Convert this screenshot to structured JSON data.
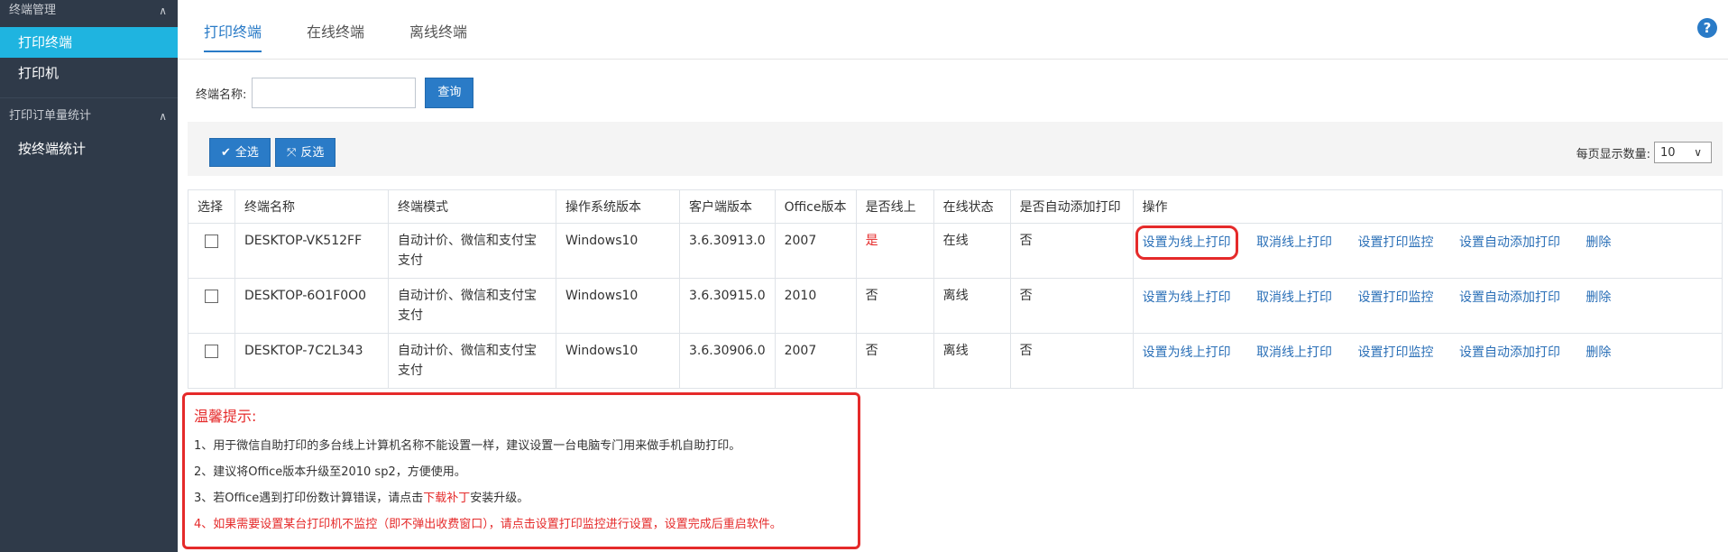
{
  "sidebar": {
    "group1": {
      "label": "终端管理",
      "chevron": "∧"
    },
    "items": [
      {
        "label": "打印终端",
        "active": true
      },
      {
        "label": "打印机",
        "active": false
      }
    ],
    "group2": {
      "label": "打印订单量统计",
      "chevron": "∧"
    },
    "items2": [
      {
        "label": "按终端统计"
      }
    ]
  },
  "tabs": [
    {
      "label": "打印终端",
      "active": true
    },
    {
      "label": "在线终端",
      "active": false
    },
    {
      "label": "离线终端",
      "active": false
    }
  ],
  "help_icon": "?",
  "filter": {
    "label": "终端名称:",
    "value": "",
    "placeholder": "",
    "query_button": "查询"
  },
  "toolbar": {
    "select_all": "全选",
    "invert": "反选",
    "page_size_label": "每页显示数量:",
    "page_size_value": "10"
  },
  "table": {
    "headers": [
      "选择",
      "终端名称",
      "终端模式",
      "操作系统版本",
      "客户端版本",
      "Office版本",
      "是否线上",
      "在线状态",
      "是否自动添加打印",
      "操作"
    ],
    "rows": [
      {
        "name": "DESKTOP-VK512FF",
        "mode": "自动计价、微信和支付宝支付",
        "os": "Windows10",
        "client": "3.6.30913.0",
        "office": "2007",
        "online": "是",
        "status": "在线",
        "auto_add": "否"
      },
      {
        "name": "DESKTOP-6O1F0O0",
        "mode": "自动计价、微信和支付宝支付",
        "os": "Windows10",
        "client": "3.6.30915.0",
        "office": "2010",
        "online": "否",
        "status": "离线",
        "auto_add": "否"
      },
      {
        "name": "DESKTOP-7C2L343",
        "mode": "自动计价、微信和支付宝支付",
        "os": "Windows10",
        "client": "3.6.30906.0",
        "office": "2007",
        "online": "否",
        "status": "离线",
        "auto_add": "否"
      }
    ],
    "actions": [
      "设置为线上打印",
      "取消线上打印",
      "设置打印监控",
      "设置自动添加打印",
      "删除"
    ]
  },
  "notice": {
    "title": "温馨提示:",
    "line1": "1、用于微信自助打印的多台线上计算机名称不能设置一样，建议设置一台电脑专门用来做手机自助打印。",
    "line2": "2、建议将Office版本升级至2010 sp2，方便使用。",
    "line3_pre": "3、若Office遇到打印份数计算错误，请点击",
    "line3_link": "下载补丁",
    "line3_post": "安装升级。",
    "line4": "4、如果需要设置某台打印机不监控（即不弹出收费窗口），请点击设置打印监控进行设置，设置完成后重启软件。"
  },
  "colors": {
    "accent": "#2a7bc7",
    "sidebar_bg": "#2f3a49",
    "active_item": "#1fb4e0",
    "alert": "#e52a2a"
  }
}
